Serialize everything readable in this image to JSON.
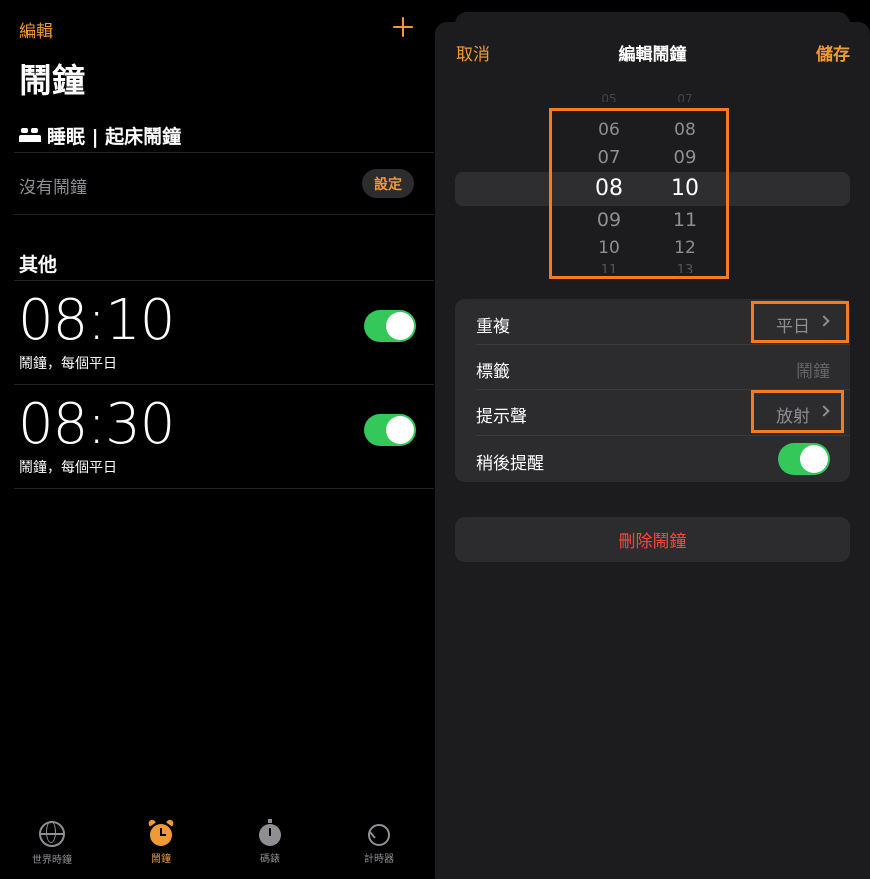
{
  "left": {
    "edit_label": "編輯",
    "title": "鬧鐘",
    "sleep_header": "睡眠 | 起床鬧鐘",
    "no_alarm": "沒有鬧鐘",
    "setup_label": "設定",
    "other_header": "其他",
    "alarms": [
      {
        "time": "08:10",
        "subtitle": "鬧鐘，每個平日",
        "enabled": true
      },
      {
        "time": "08:30",
        "subtitle": "鬧鐘，每個平日",
        "enabled": true
      }
    ],
    "tabs": [
      {
        "label": "世界時鐘",
        "icon": "globe-icon",
        "active": false
      },
      {
        "label": "鬧鐘",
        "icon": "alarm-clock-icon",
        "active": true
      },
      {
        "label": "碼錶",
        "icon": "stopwatch-icon",
        "active": false
      },
      {
        "label": "計時器",
        "icon": "timer-icon",
        "active": false
      }
    ]
  },
  "right": {
    "cancel_label": "取消",
    "title": "編輯鬧鐘",
    "save_label": "儲存",
    "picker": {
      "hours": [
        "05",
        "06",
        "07",
        "08",
        "09",
        "10",
        "11"
      ],
      "minutes": [
        "07",
        "08",
        "09",
        "10",
        "11",
        "12",
        "13"
      ],
      "selected_hour": "08",
      "selected_minute": "10"
    },
    "rows": {
      "repeat_label": "重複",
      "repeat_value": "平日",
      "label_label": "標籤",
      "label_value": "鬧鐘",
      "sound_label": "提示聲",
      "sound_value": "放射",
      "snooze_label": "稍後提醒",
      "snooze_enabled": true
    },
    "delete_label": "刪除鬧鐘"
  },
  "colors": {
    "accent": "#f09a37",
    "toggle_on": "#34c759",
    "destructive": "#ff453a",
    "highlight_box": "#f47b20"
  }
}
